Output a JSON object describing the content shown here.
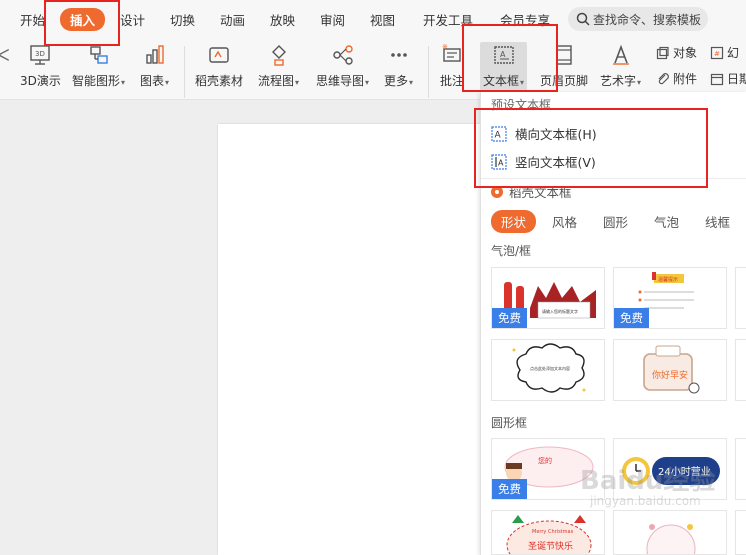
{
  "menu": {
    "items": [
      "开始",
      "插入",
      "设计",
      "切换",
      "动画",
      "放映",
      "审阅",
      "视图",
      "开发工具",
      "会员专享"
    ],
    "active": "插入",
    "search_placeholder": "查找命令、搜索模板"
  },
  "ribbon": {
    "tools": [
      {
        "label": "3D演示",
        "icon": "3d-icon"
      },
      {
        "label": "智能图形",
        "icon": "smart-graphic-icon",
        "dropdown": true
      },
      {
        "label": "图表",
        "icon": "chart-icon",
        "dropdown": true
      },
      {
        "label": "稻壳素材",
        "icon": "material-icon"
      },
      {
        "label": "流程图",
        "icon": "flowchart-icon",
        "dropdown": true
      },
      {
        "label": "思维导图",
        "icon": "mindmap-icon",
        "dropdown": true
      },
      {
        "label": "更多",
        "icon": "more-icon",
        "dropdown": true
      },
      {
        "label": "批注",
        "icon": "comment-icon"
      },
      {
        "label": "文本框",
        "icon": "textbox-icon",
        "dropdown": true,
        "selected": true
      },
      {
        "label": "页眉页脚",
        "icon": "header-footer-icon"
      },
      {
        "label": "艺术字",
        "icon": "wordart-icon",
        "dropdown": true
      }
    ],
    "small_tools": [
      {
        "label": "对象",
        "icon": "object-icon"
      },
      {
        "label": "附件",
        "icon": "attachment-icon"
      },
      {
        "label": "幻",
        "icon": "slide-number-icon"
      },
      {
        "label": "日期",
        "icon": "date-icon"
      }
    ]
  },
  "dropdown": {
    "preset_title": "预设文本框",
    "preset_items": [
      {
        "label": "横向文本框(H)",
        "icon": "horizontal-textbox-icon"
      },
      {
        "label": "竖向文本框(V)",
        "icon": "vertical-textbox-icon"
      }
    ],
    "daoke_title": "稻壳文本框",
    "tabs": [
      "形状",
      "风格",
      "圆形",
      "气泡",
      "线框"
    ],
    "active_tab": "形状",
    "categories": [
      {
        "title": "气泡/框"
      },
      {
        "title": "圆形框"
      }
    ],
    "free_badge": "免费",
    "thumb_texts": {
      "t1": "请输入您的标题文字",
      "t2": "温馨提示",
      "t3": "点击此处添加文本内容",
      "t4": "你好早安",
      "t5": "您的",
      "t6": "24小时营业",
      "t7": "Merry Christmas",
      "t8": "圣诞节快乐"
    }
  },
  "watermark": {
    "text": "Baidu经验",
    "sub": "jingyan.baidu.com"
  },
  "colors": {
    "accent": "#ef6a2e",
    "highlight": "#e8241f",
    "free_badge": "#3a7ee8"
  }
}
